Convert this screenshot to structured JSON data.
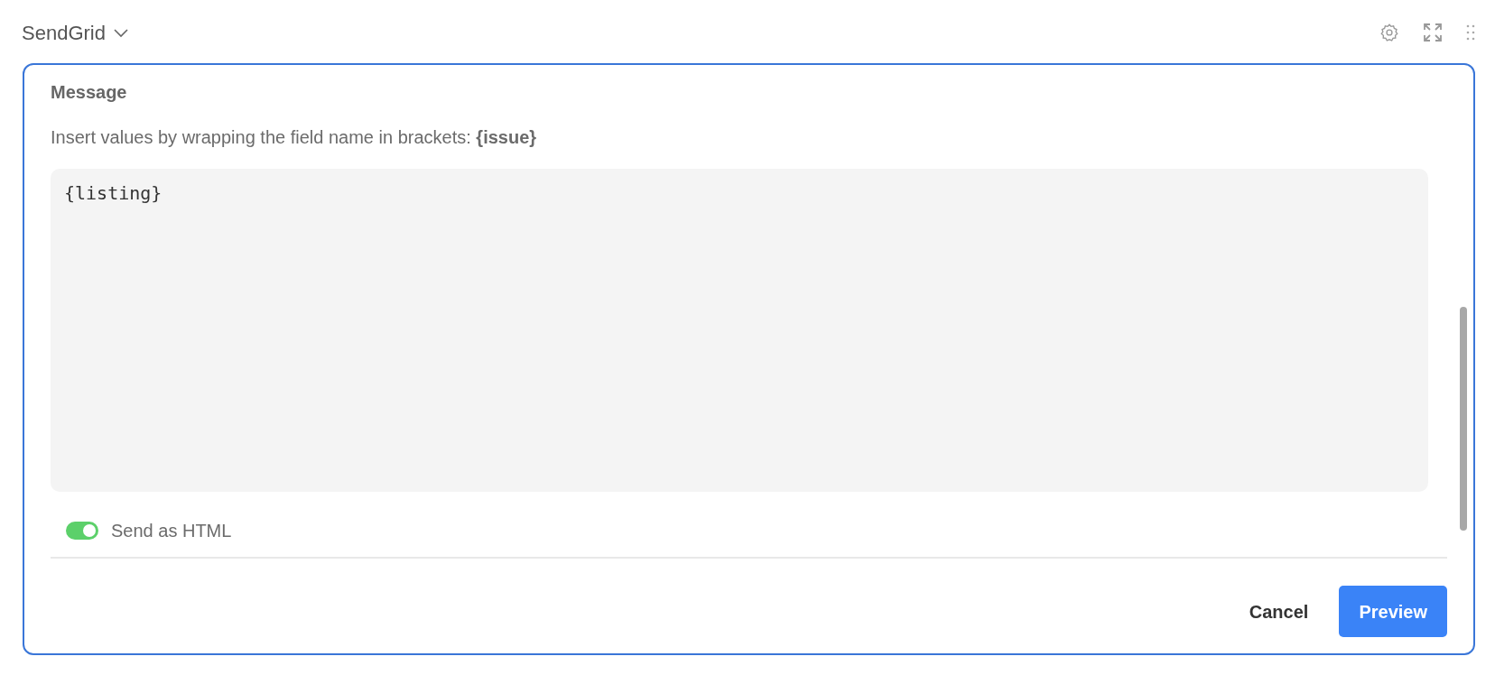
{
  "header": {
    "title": "SendGrid"
  },
  "message": {
    "label": "Message",
    "hint": "Insert values by wrapping the field name in brackets: **{issue}**",
    "value": "{listing}"
  },
  "toggle": {
    "label": "Send as HTML",
    "on": true
  },
  "buttons": [
    {
      "label": "Cancel",
      "kind": "secondary"
    },
    {
      "label": "Preview",
      "kind": "primary"
    }
  ]
}
